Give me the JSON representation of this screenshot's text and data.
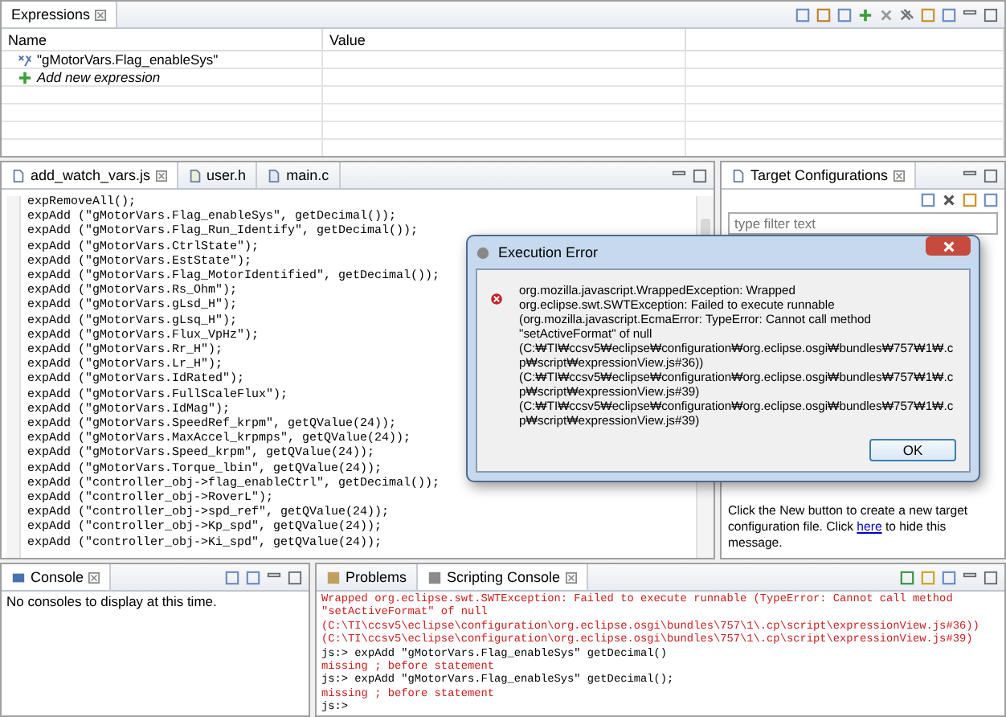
{
  "expressions": {
    "tab": "Expressions",
    "columns": [
      "Name",
      "Value"
    ],
    "rows": [
      {
        "kind": "expression",
        "name": "\"gMotorVars.Flag_enableSys\""
      },
      {
        "kind": "add",
        "name": "Add new expression"
      }
    ]
  },
  "editor": {
    "tabs": [
      {
        "label": "add_watch_vars.js",
        "selected": true,
        "kind": "js"
      },
      {
        "label": "user.h",
        "selected": false,
        "kind": "h"
      },
      {
        "label": "main.c",
        "selected": false,
        "kind": "c"
      }
    ],
    "lines": [
      "expRemoveAll();",
      "expAdd (\"gMotorVars.Flag_enableSys\", getDecimal());",
      "expAdd (\"gMotorVars.Flag_Run_Identify\", getDecimal());",
      "expAdd (\"gMotorVars.CtrlState\");",
      "expAdd (\"gMotorVars.EstState\");",
      "expAdd (\"gMotorVars.Flag_MotorIdentified\", getDecimal());",
      "expAdd (\"gMotorVars.Rs_Ohm\");",
      "expAdd (\"gMotorVars.gLsd_H\");",
      "expAdd (\"gMotorVars.gLsq_H\");",
      "expAdd (\"gMotorVars.Flux_VpHz\");",
      "expAdd (\"gMotorVars.Rr_H\");",
      "expAdd (\"gMotorVars.Lr_H\");",
      "expAdd (\"gMotorVars.IdRated\");",
      "expAdd (\"gMotorVars.FullScaleFlux\");",
      "expAdd (\"gMotorVars.IdMag\");",
      "expAdd (\"gMotorVars.SpeedRef_krpm\", getQValue(24));",
      "expAdd (\"gMotorVars.MaxAccel_krpmps\", getQValue(24));",
      "expAdd (\"gMotorVars.Speed_krpm\", getQValue(24));",
      "expAdd (\"gMotorVars.Torque_lbin\", getQValue(24));",
      "expAdd (\"controller_obj->flag_enableCtrl\", getDecimal());",
      "expAdd (\"controller_obj->RoverL\");",
      "expAdd (\"controller_obj->spd_ref\", getQValue(24));",
      "expAdd (\"controller_obj->Kp_spd\", getQValue(24));",
      "expAdd (\"controller_obj->Ki_spd\", getQValue(24));"
    ]
  },
  "target_configurations": {
    "tab": "Target Configurations",
    "filter": {
      "placeholder": "type filter text"
    },
    "message_before": "Click the New button to create a new target configuration file. Click ",
    "link": "here",
    "message_after": " to hide this message."
  },
  "console": {
    "tab": "Console",
    "message": "No consoles to display at this time."
  },
  "scripting": {
    "tabs": [
      {
        "label": "Problems",
        "selected": false,
        "kind": "problems"
      },
      {
        "label": "Scripting Console",
        "selected": true,
        "kind": "console"
      }
    ],
    "lines": [
      {
        "kind": "error",
        "text": "Wrapped org.eclipse.swt.SWTException: Failed to execute runnable (TypeError: Cannot call method"
      },
      {
        "kind": "error",
        "text": "\"setActiveFormat\" of null"
      },
      {
        "kind": "error",
        "text": "(C:\\TI\\ccsv5\\eclipse\\configuration\\org.eclipse.osgi\\bundles\\757\\1\\.cp\\script\\expressionView.js#36))"
      },
      {
        "kind": "error",
        "text": "(C:\\TI\\ccsv5\\eclipse\\configuration\\org.eclipse.osgi\\bundles\\757\\1\\.cp\\script\\expressionView.js#39)"
      },
      {
        "kind": "input",
        "text": "js:> expAdd \"gMotorVars.Flag_enableSys\" getDecimal()"
      },
      {
        "kind": "error",
        "text": "missing ; before statement"
      },
      {
        "kind": "input",
        "text": "js:> expAdd \"gMotorVars.Flag_enableSys\" getDecimal();"
      },
      {
        "kind": "error",
        "text": "missing ; before statement"
      },
      {
        "kind": "input",
        "text": "js:>"
      }
    ]
  },
  "dialog": {
    "title": "Execution Error",
    "paragraphs": [
      "org.mozilla.javascript.WrappedException: Wrapped org.eclipse.swt.SWTException: Failed to execute runnable (org.mozilla.javascript.EcmaError: TypeError: Cannot call method \"setActiveFormat\" of null",
      "(C:₩TI₩ccsv5₩eclipse₩configuration₩org.eclipse.osgi₩bundles₩757₩1₩.cp₩script₩expressionView.js#36))",
      "(C:₩TI₩ccsv5₩eclipse₩configuration₩org.eclipse.osgi₩bundles₩757₩1₩.cp₩script₩expressionView.js#39)",
      "(C:₩TI₩ccsv5₩eclipse₩configuration₩org.eclipse.osgi₩bundles₩757₩1₩.cp₩script₩expressionView.js#39)"
    ],
    "button": "OK"
  }
}
